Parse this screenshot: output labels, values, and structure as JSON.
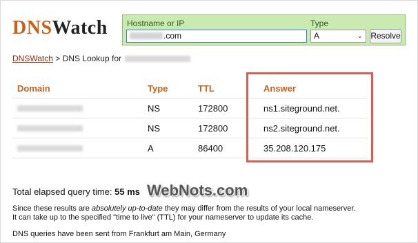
{
  "logo": {
    "part1": "DNS",
    "part2": "Watch"
  },
  "search": {
    "hostname_label": "Hostname or IP",
    "hostname_suffix": ".com",
    "type_label": "Type",
    "type_value": "A",
    "resolve_label": "Resolve"
  },
  "breadcrumb": {
    "home": "DNSWatch",
    "separator": ">",
    "current": "DNS Lookup for"
  },
  "table": {
    "headers": [
      "Domain",
      "Type",
      "TTL",
      "Answer"
    ],
    "rows": [
      {
        "type": "NS",
        "ttl": "172800",
        "answer": "ns1.siteground.net."
      },
      {
        "type": "NS",
        "ttl": "172800",
        "answer": "ns2.siteground.net."
      },
      {
        "type": "A",
        "ttl": "86400",
        "answer": "35.208.120.175"
      }
    ]
  },
  "colors": {
    "accent": "#c8621b",
    "highlight": "#e5584b",
    "search_bg": "#c9eab0"
  },
  "footer": {
    "elapsed_label": "Total elapsed query time:",
    "elapsed_value": "55 ms",
    "watermark": "WebNots.com",
    "note_prefix": "Since these results are",
    "note_emphasis": "absolutely up-to-date",
    "note_suffix": "they may differ from the results of your local nameserver.",
    "note_line2": "It can take up to the specified \"time to live\" (TTL) for your nameserver to update its cache.",
    "origin": "DNS queries have been sent from Frankfurt am Main, Germany"
  }
}
